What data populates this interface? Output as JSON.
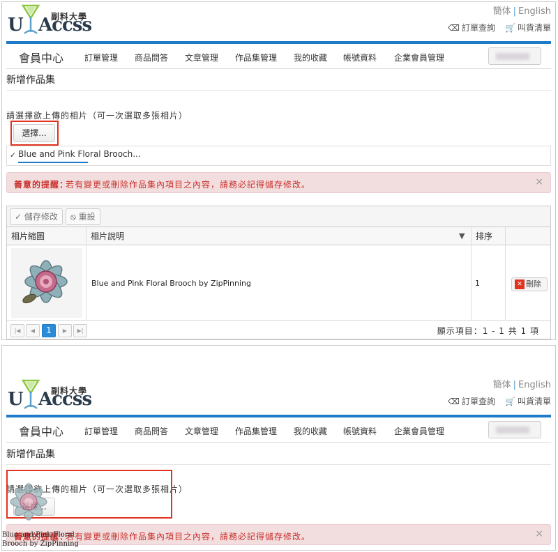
{
  "header": {
    "logo_cn": "副料大學",
    "logo_u": "U",
    "logo_accss": "Accss",
    "lang_simplified": "簡体",
    "lang_english": "English",
    "order_query": "訂單查詢",
    "cart": "叫貨清單"
  },
  "nav": {
    "home": "會員中心",
    "items": [
      "訂單管理",
      "商品問答",
      "文章管理",
      "作品集管理",
      "我的收藏",
      "帳號資料",
      "企業會員管理"
    ]
  },
  "page": {
    "title": "新增作品集",
    "upload_hint": "請選擇欲上傳的相片（可一次選取多張相片）",
    "select_button": "選擇...",
    "file_name": "Blue and Pink Floral Brooch...",
    "alert_label": "善意的提醒：",
    "alert_message": "若有變更或刪除作品集內項目之內容，請務必記得儲存修改。"
  },
  "grid": {
    "save_button": "儲存修改",
    "reset_button": "重設",
    "columns": [
      "相片縮圖",
      "相片說明",
      "排序"
    ],
    "rows": [
      {
        "description": "Blue and Pink Floral Brooch by ZipPinning",
        "order": "1",
        "delete": "刪除"
      }
    ],
    "pager": {
      "current_page": "1",
      "info": "顯示項目：1 - 1 共 1 項"
    }
  },
  "drag_ghost": {
    "line1": "Blue and Pink Floral",
    "line2": "Brooch by ZipPinning",
    "overlay_text": "善意的提醒"
  },
  "colors": {
    "accent": "#1f7bc7",
    "highlight": "#e0321e",
    "alert_bg": "#f2dede",
    "alert_text": "#c9302c"
  }
}
